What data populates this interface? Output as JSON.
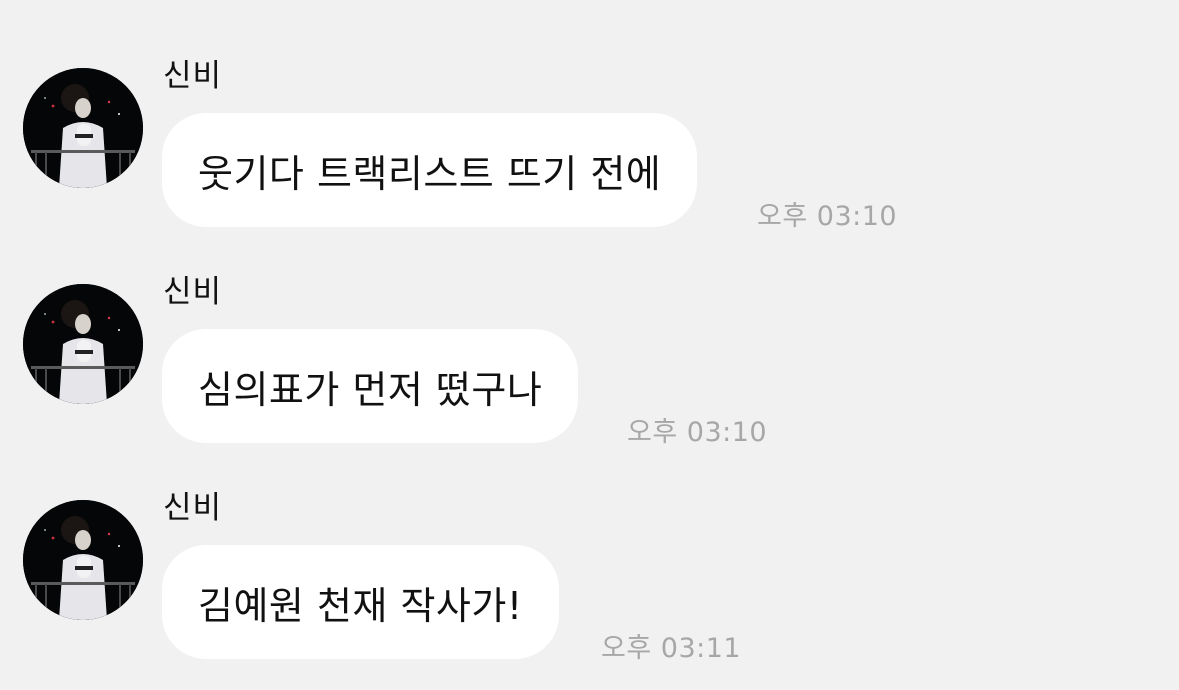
{
  "messages": [
    {
      "sender": "신비",
      "avatar_icon": "profile-photo-icon",
      "text": "웃기다 트랙리스트 뜨기 전에",
      "time": "오후 03:10"
    },
    {
      "sender": "신비",
      "avatar_icon": "profile-photo-icon",
      "text": "심의표가 먼저 떴구나",
      "time": "오후 03:10"
    },
    {
      "sender": "신비",
      "avatar_icon": "profile-photo-icon",
      "text": "김예원 천재 작사가!",
      "time": "오후 03:11"
    }
  ],
  "colors": {
    "background": "#f1f1f1",
    "bubble": "#ffffff",
    "text": "#111111",
    "timestamp": "#a7a7a7"
  }
}
